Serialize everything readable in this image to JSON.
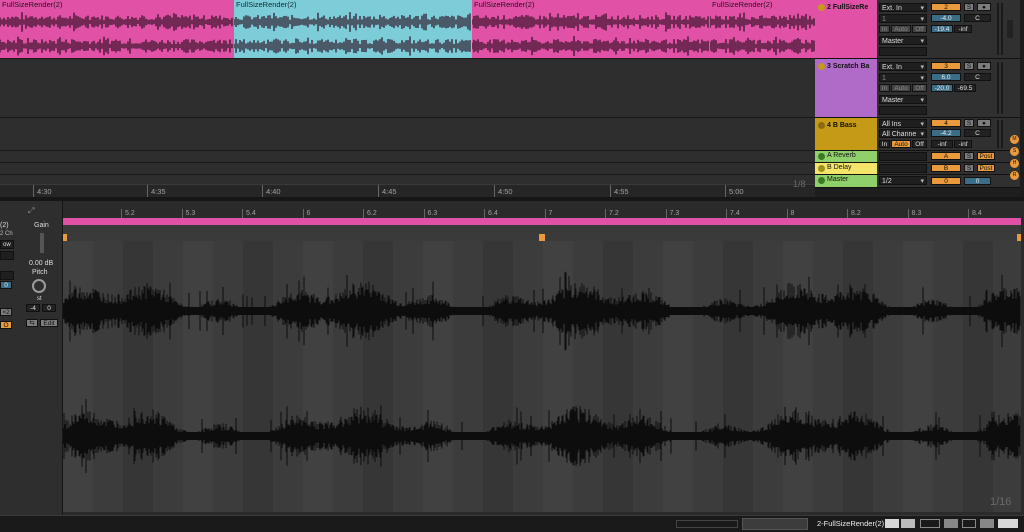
{
  "colors": {
    "pink": "#e152a6",
    "blue": "#7ccdd8",
    "purple": "#b06ac7",
    "gold": "#c49a16",
    "green": "#8fd06a",
    "yellow": "#f3e56a",
    "orange": "#e89a3c"
  },
  "clips": [
    {
      "name": "FullSizeRender(2)",
      "selected": false
    },
    {
      "name": "FullSizeRender(2)",
      "selected": true
    },
    {
      "name": "FullSizeRender(2)",
      "selected": false
    },
    {
      "name": "FullSizeRender(2)",
      "selected": false
    }
  ],
  "ruler": {
    "ticks": [
      "4:30",
      "4:35",
      "4:40",
      "4:45",
      "4:50",
      "4:55",
      "5:00"
    ],
    "zoom": "1/8"
  },
  "tracks": [
    {
      "name": "2 FullSizeRe",
      "input": "Ext. In",
      "channel": "1",
      "monitor": [
        "In",
        "Auto",
        "Off"
      ],
      "output": "Master",
      "number": "2",
      "volume": "-4.0",
      "pan": "C",
      "level1": "-19.4",
      "level2": "-inf"
    },
    {
      "name": "3 Scratch Ba",
      "input": "Ext. In",
      "channel": "1",
      "monitor": [
        "In",
        "Auto",
        "Off"
      ],
      "output": "Master",
      "number": "3",
      "volume": "6.0",
      "pan": "C",
      "level1": "-20.0",
      "level2": "-69.5"
    },
    {
      "name": "4 B Bass",
      "input": "All Ins",
      "channel": "All Channe",
      "monitor": [
        "In",
        "Auto",
        "Off"
      ],
      "output": "",
      "number": "4",
      "volume": "-4.2",
      "pan": "C",
      "level1": "-inf",
      "level2": "-inf"
    }
  ],
  "returns": [
    {
      "name": "A Reverb",
      "letter": "A",
      "solo": "S",
      "post": "Post"
    },
    {
      "name": "B Delay",
      "letter": "B",
      "solo": "S",
      "post": "Post"
    }
  ],
  "master": {
    "name": "Master",
    "output": "1/2",
    "vol1": "0",
    "vol2": "0"
  },
  "side_letters": [
    "M",
    "S",
    "H",
    "R"
  ],
  "clip_panel": {
    "name_frag": "(2)",
    "ch_frag": "2 Ch",
    "warp_frag": "ow",
    "val_frag": "0",
    "x2": "×2",
    "gain_label": "Gain",
    "gain_value": "0.00 dB",
    "pitch_label": "Pitch",
    "pitch_unit": "st",
    "pitch_value": "-4",
    "pitch_fine": "0",
    "edit_label": "Edit"
  },
  "sample_ruler": [
    "5.2",
    "5.3",
    "5.4",
    "6",
    "6.2",
    "6.3",
    "6.4",
    "7",
    "7.2",
    "7.3",
    "7.4",
    "8",
    "8.2",
    "8.3",
    "8.4"
  ],
  "detail_zoom": "1/16",
  "status": {
    "clip_name": "2-FullSizeRender(2)"
  }
}
